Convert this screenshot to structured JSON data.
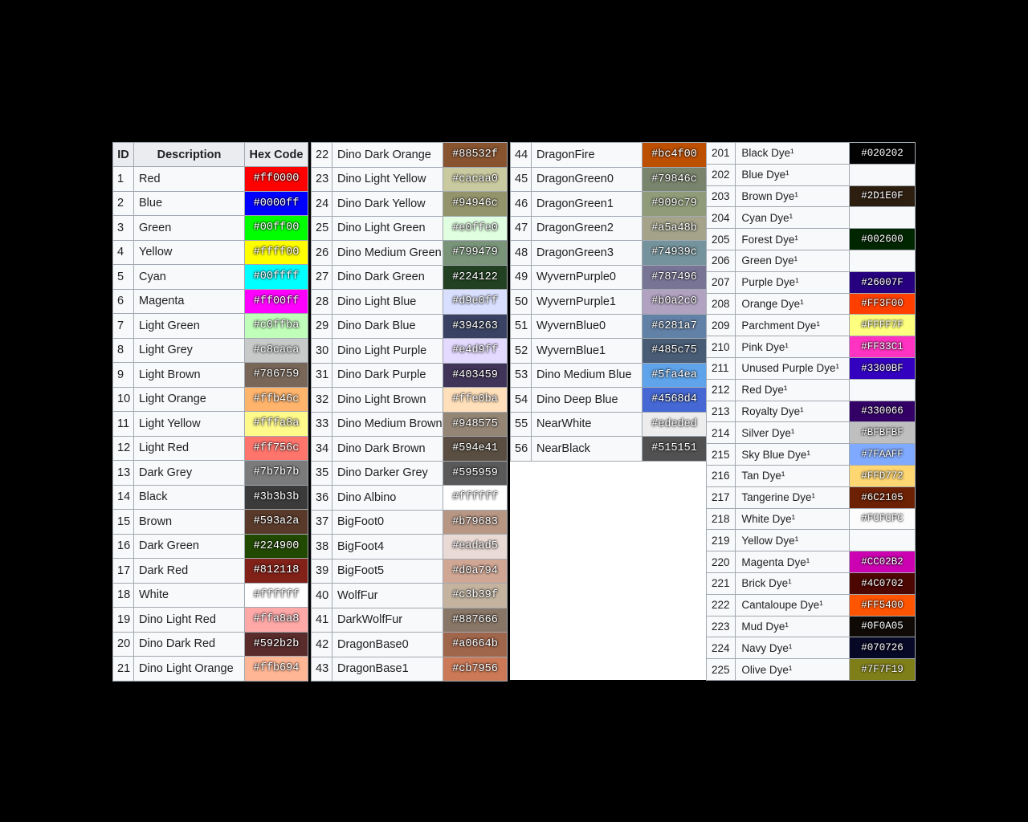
{
  "headers": {
    "id": "ID",
    "description": "Description",
    "hex": "Hex Code"
  },
  "panels": [
    {
      "rows": [
        {
          "id": "1",
          "name": "Red",
          "hex": "#ff0000"
        },
        {
          "id": "2",
          "name": "Blue",
          "hex": "#0000ff"
        },
        {
          "id": "3",
          "name": "Green",
          "hex": "#00ff00"
        },
        {
          "id": "4",
          "name": "Yellow",
          "hex": "#ffff00"
        },
        {
          "id": "5",
          "name": "Cyan",
          "hex": "#00ffff"
        },
        {
          "id": "6",
          "name": "Magenta",
          "hex": "#ff00ff"
        },
        {
          "id": "7",
          "name": "Light Green",
          "hex": "#c0ffba"
        },
        {
          "id": "8",
          "name": "Light Grey",
          "hex": "#c8caca"
        },
        {
          "id": "9",
          "name": "Light Brown",
          "hex": "#786759"
        },
        {
          "id": "10",
          "name": "Light Orange",
          "hex": "#ffb46c"
        },
        {
          "id": "11",
          "name": "Light Yellow",
          "hex": "#fffa8a"
        },
        {
          "id": "12",
          "name": "Light Red",
          "hex": "#ff756c"
        },
        {
          "id": "13",
          "name": "Dark Grey",
          "hex": "#7b7b7b"
        },
        {
          "id": "14",
          "name": "Black",
          "hex": "#3b3b3b"
        },
        {
          "id": "15",
          "name": "Brown",
          "hex": "#593a2a"
        },
        {
          "id": "16",
          "name": "Dark Green",
          "hex": "#224900"
        },
        {
          "id": "17",
          "name": "Dark Red",
          "hex": "#812118"
        },
        {
          "id": "18",
          "name": "White",
          "hex": "#ffffff"
        },
        {
          "id": "19",
          "name": "Dino Light Red",
          "hex": "#ffa8a8"
        },
        {
          "id": "20",
          "name": "Dino Dark Red",
          "hex": "#592b2b"
        },
        {
          "id": "21",
          "name": "Dino Light Orange",
          "hex": "#ffb694"
        }
      ]
    },
    {
      "rows": [
        {
          "id": "22",
          "name": "Dino Dark Orange",
          "hex": "#88532f"
        },
        {
          "id": "23",
          "name": "Dino Light Yellow",
          "hex": "#cacaa0"
        },
        {
          "id": "24",
          "name": "Dino Dark Yellow",
          "hex": "#94946c"
        },
        {
          "id": "25",
          "name": "Dino Light Green",
          "hex": "#e0ffe0"
        },
        {
          "id": "26",
          "name": "Dino Medium Green",
          "hex": "#799479"
        },
        {
          "id": "27",
          "name": "Dino Dark Green",
          "hex": "#224122"
        },
        {
          "id": "28",
          "name": "Dino Light Blue",
          "hex": "#d9e0ff"
        },
        {
          "id": "29",
          "name": "Dino Dark Blue",
          "hex": "#394263"
        },
        {
          "id": "30",
          "name": "Dino Light Purple",
          "hex": "#e4d9ff"
        },
        {
          "id": "31",
          "name": "Dino Dark Purple",
          "hex": "#403459"
        },
        {
          "id": "32",
          "name": "Dino Light Brown",
          "hex": "#ffe0ba"
        },
        {
          "id": "33",
          "name": "Dino Medium Brown",
          "hex": "#948575"
        },
        {
          "id": "34",
          "name": "Dino Dark Brown",
          "hex": "#594e41"
        },
        {
          "id": "35",
          "name": "Dino Darker Grey",
          "hex": "#595959"
        },
        {
          "id": "36",
          "name": "Dino Albino",
          "hex": "#ffffff"
        },
        {
          "id": "37",
          "name": "BigFoot0",
          "hex": "#b79683"
        },
        {
          "id": "38",
          "name": "BigFoot4",
          "hex": "#eadad5"
        },
        {
          "id": "39",
          "name": "BigFoot5",
          "hex": "#d0a794"
        },
        {
          "id": "40",
          "name": "WolfFur",
          "hex": "#c3b39f"
        },
        {
          "id": "41",
          "name": "DarkWolfFur",
          "hex": "#887666"
        },
        {
          "id": "42",
          "name": "DragonBase0",
          "hex": "#a0664b"
        },
        {
          "id": "43",
          "name": "DragonBase1",
          "hex": "#cb7956"
        }
      ]
    },
    {
      "rows": [
        {
          "id": "44",
          "name": "DragonFire",
          "hex": "#bc4f00"
        },
        {
          "id": "45",
          "name": "DragonGreen0",
          "hex": "#79846c"
        },
        {
          "id": "46",
          "name": "DragonGreen1",
          "hex": "#909c79"
        },
        {
          "id": "47",
          "name": "DragonGreen2",
          "hex": "#a5a48b"
        },
        {
          "id": "48",
          "name": "DragonGreen3",
          "hex": "#74939c"
        },
        {
          "id": "49",
          "name": "WyvernPurple0",
          "hex": "#787496"
        },
        {
          "id": "50",
          "name": "WyvernPurple1",
          "hex": "#b0a2c0"
        },
        {
          "id": "51",
          "name": "WyvernBlue0",
          "hex": "#6281a7"
        },
        {
          "id": "52",
          "name": "WyvernBlue1",
          "hex": "#485c75"
        },
        {
          "id": "53",
          "name": "Dino Medium Blue",
          "hex": "#5fa4ea"
        },
        {
          "id": "54",
          "name": "Dino Deep Blue",
          "hex": "#4568d4"
        },
        {
          "id": "55",
          "name": "NearWhite",
          "hex": "#ededed"
        },
        {
          "id": "56",
          "name": "NearBlack",
          "hex": "#515151"
        }
      ]
    },
    {
      "rows": [
        {
          "id": "201",
          "name": "Black Dye¹",
          "hex": "#020202"
        },
        {
          "id": "202",
          "name": "Blue Dye¹",
          "hex": ""
        },
        {
          "id": "203",
          "name": "Brown Dye¹",
          "hex": "#2D1E0F"
        },
        {
          "id": "204",
          "name": "Cyan Dye¹",
          "hex": ""
        },
        {
          "id": "205",
          "name": "Forest Dye¹",
          "hex": "#002600"
        },
        {
          "id": "206",
          "name": "Green Dye¹",
          "hex": ""
        },
        {
          "id": "207",
          "name": "Purple Dye¹",
          "hex": "#26007F"
        },
        {
          "id": "208",
          "name": "Orange Dye¹",
          "hex": "#FF3F00"
        },
        {
          "id": "209",
          "name": "Parchment Dye¹",
          "hex": "#FFFF7F"
        },
        {
          "id": "210",
          "name": "Pink Dye¹",
          "hex": "#FF33C1"
        },
        {
          "id": "211",
          "name": "Unused Purple Dye¹",
          "hex": "#3300BF"
        },
        {
          "id": "212",
          "name": "Red Dye¹",
          "hex": ""
        },
        {
          "id": "213",
          "name": "Royalty Dye¹",
          "hex": "#330066"
        },
        {
          "id": "214",
          "name": "Silver Dye¹",
          "hex": "#BFBFBF"
        },
        {
          "id": "215",
          "name": "Sky Blue Dye¹",
          "hex": "#7FAAFF"
        },
        {
          "id": "216",
          "name": "Tan Dye¹",
          "hex": "#FFD772"
        },
        {
          "id": "217",
          "name": "Tangerine Dye¹",
          "hex": "#6C2105"
        },
        {
          "id": "218",
          "name": "White Dye¹",
          "hex": "#FCFCFC"
        },
        {
          "id": "219",
          "name": "Yellow Dye¹",
          "hex": ""
        },
        {
          "id": "220",
          "name": "Magenta Dye¹",
          "hex": "#CC02B2"
        },
        {
          "id": "221",
          "name": "Brick Dye¹",
          "hex": "#4C0702"
        },
        {
          "id": "222",
          "name": "Cantaloupe Dye¹",
          "hex": "#FF5400"
        },
        {
          "id": "223",
          "name": "Mud Dye¹",
          "hex": "#0F0A05"
        },
        {
          "id": "224",
          "name": "Navy Dye¹",
          "hex": "#070726"
        },
        {
          "id": "225",
          "name": "Olive Dye¹",
          "hex": "#7F7F19"
        }
      ]
    }
  ]
}
